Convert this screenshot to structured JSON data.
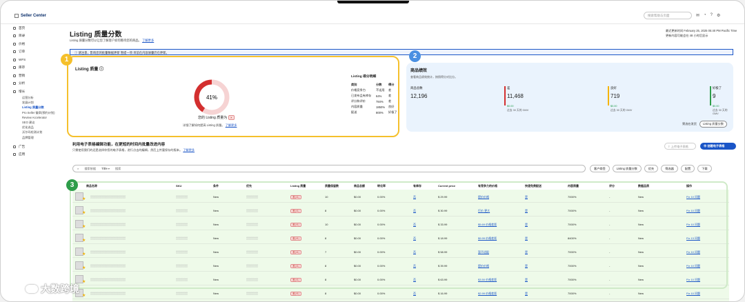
{
  "app": {
    "name": "Seller Center",
    "search_placeholder": "搜索帮助与页面"
  },
  "sidebar": {
    "items": [
      {
        "label": "首页",
        "type": "item"
      },
      {
        "label": "目录",
        "type": "item"
      },
      {
        "label": "价格",
        "type": "item"
      },
      {
        "label": "订单",
        "type": "item"
      },
      {
        "label": "WFS",
        "type": "item"
      },
      {
        "label": "库存",
        "type": "item"
      },
      {
        "label": "营销",
        "type": "item"
      },
      {
        "label": "分析",
        "type": "item"
      },
      {
        "label": "增长",
        "type": "item"
      },
      {
        "label": "运营分析",
        "type": "sub"
      },
      {
        "label": "发展计划",
        "type": "sub"
      },
      {
        "label": "Listing 质量分数",
        "type": "sub",
        "active": true
      },
      {
        "label": "Pro Seller 徽章(预约计划)",
        "type": "sub"
      },
      {
        "label": "Review Accelerator",
        "type": "sub"
      },
      {
        "label": "SEO 建议",
        "type": "sub"
      },
      {
        "label": "优化选品",
        "type": "sub"
      },
      {
        "label": "沃尔玛检测计划",
        "type": "sub"
      },
      {
        "label": "品牌管理",
        "type": "sub"
      },
      {
        "label": "广告",
        "type": "item"
      },
      {
        "label": "应用",
        "type": "item"
      }
    ]
  },
  "header": {
    "title": "Listing 质量分数",
    "subtitle": "Listing 质量分数可以让您了解客户如何看待您的商品。",
    "subtitle_link": "了解更多",
    "updated": "最近更新时间 February 25, 2025 05:40 PM Pacific Time",
    "updated_note": "更新内容可能会在 48 小时后显示"
  },
  "notice": {
    "text": "请注意，影响您的批量数据更新 暂提一项 目前在内容质量仍在更新。"
  },
  "quality": {
    "title": "Listing 质量",
    "percent": "41%",
    "percent_value": 41,
    "label": "您的 Listing 质量为",
    "link_text": "详细了解如何提高 Listing 质量。",
    "link": "了解更多",
    "detail": {
      "title": "Listing 得分明细",
      "headers": [
        "类别",
        "分数",
        "得分"
      ],
      "rows": [
        [
          "价格竞争力",
          "不适用",
          "差"
        ],
        [
          "已发布且有库存",
          "64%",
          "差"
        ],
        [
          "评分和评价",
          "784%",
          "差"
        ],
        [
          "内容质量",
          "1850%",
          "良好"
        ],
        [
          "配送",
          "800%",
          "好极了"
        ]
      ]
    }
  },
  "performance": {
    "title": "商品绩效",
    "subtitle": "查看商品绩效统计，按照得分对比分。",
    "metrics": [
      {
        "label": "商品总数",
        "value": "12,196",
        "change": "",
        "compare": "",
        "color": ""
      },
      {
        "label": "差",
        "value": "11,468",
        "change": "$0.00",
        "compare": "过去 30 天的 GMV",
        "color": "#d32f2f"
      },
      {
        "label": "良好",
        "value": "719",
        "change": "$0.00",
        "compare": "过去 30 天的 GMV",
        "color": "#f5b301"
      },
      {
        "label": "好极了",
        "value": "9",
        "change": "$0.00",
        "compare": "过去 30 天的 GMV",
        "color": "#2e9d4a"
      }
    ],
    "footer_label": "筛选在发货",
    "footer_btn": "Listing 质量分数"
  },
  "bulk": {
    "title": "利用电子表格编辑功能，在更短的时间内批量改进内容",
    "subtitle": "只需使用我们的还是选择你您的电子表格，进行点击的编辑，然后上传要保存的版本。",
    "link": "了解更多",
    "upload": "上传电子表格",
    "create": "创建电子表格"
  },
  "filter": {
    "scope": "搜索依据",
    "field": "Title",
    "placeholder": "搜索",
    "buttons": [
      "客户商签",
      "Listing 质量分数",
      "优先",
      "筛选器",
      "配置",
      "下载"
    ]
  },
  "table": {
    "headers": [
      "商品名称",
      "SKU",
      "条件",
      "优先",
      "Listing 质量",
      "质量保留数",
      "商品总额",
      "转化率",
      "有库存",
      "Current price",
      "有竞争力的价格",
      "快速免费配送",
      "内容质量",
      "评分",
      "数据品质",
      "操作"
    ],
    "rows": [
      {
        "qty": "10",
        "total": "$0.00",
        "conv": "0.00%",
        "stock": "否",
        "price": "$ 29.99",
        "compete": "提价价格",
        "ship": "是",
        "content": "7000%",
        "rate": "-",
        "action": "Fix 10 问题"
      },
      {
        "qty": "8",
        "total": "$0.00",
        "conv": "0.00%",
        "stock": "否",
        "price": "$ 30.99",
        "compete": "打价 更大",
        "ship": "是",
        "content": "7000%",
        "rate": "-",
        "action": "Fix 10 问题"
      },
      {
        "qty": "10",
        "total": "$0.00",
        "conv": "0.00%",
        "stock": "否",
        "price": "$ 33.99",
        "compete": "$5.69 价格差距",
        "ship": "是",
        "content": "7000%",
        "rate": "-",
        "action": "Fix 10 问题"
      },
      {
        "qty": "8",
        "total": "$0.00",
        "conv": "0.00%",
        "stock": "否",
        "price": "$ 18.99",
        "compete": "$9.99 价格差距",
        "ship": "是",
        "content": "8400%",
        "rate": "-",
        "action": "Fix 13 问题"
      },
      {
        "qty": "7",
        "total": "$0.00",
        "conv": "0.00%",
        "stock": "否",
        "price": "$ 58.99",
        "compete": "暂不适配",
        "ship": "是",
        "content": "7000%",
        "rate": "-",
        "action": "Fix 10 问题"
      },
      {
        "qty": "8",
        "total": "$0.00",
        "conv": "0.00%",
        "stock": "否",
        "price": "$ 39.99",
        "compete": "提价价格",
        "ship": "是",
        "content": "7000%",
        "rate": "-",
        "action": "Fix 10 问题"
      },
      {
        "qty": "8",
        "total": "$0.00",
        "conv": "0.00%",
        "stock": "否",
        "price": "$ 63.99",
        "compete": "$3.50 价格差距",
        "ship": "是",
        "content": "7000%",
        "rate": "-",
        "action": "Fix 10 问题"
      },
      {
        "qty": "8",
        "total": "$0.00",
        "conv": "0.00%",
        "stock": "否",
        "price": "$ 16.99",
        "compete": "$2.99 价格差距",
        "ship": "是",
        "content": "7000%",
        "rate": "-",
        "action": "Fix 10 问题"
      }
    ],
    "condition": "New",
    "tag": "差(41)"
  },
  "badges": [
    "1",
    "2",
    "3"
  ],
  "watermark": "大数跨境",
  "colors": {
    "accent": "#1a55c7",
    "yellow": "#f5c02b",
    "blue_badge": "#4a90e2",
    "green_badge": "#2e9d4a",
    "red": "#d32f2f"
  }
}
